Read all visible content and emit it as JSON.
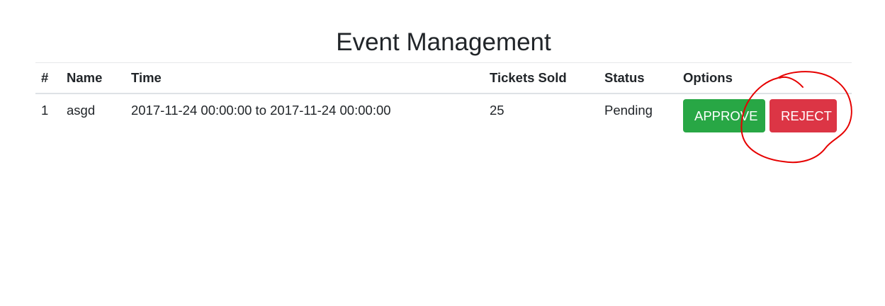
{
  "page": {
    "title": "Event Management"
  },
  "table": {
    "headers": {
      "num": "#",
      "name": "Name",
      "time": "Time",
      "tickets_sold": "Tickets Sold",
      "status": "Status",
      "options": "Options"
    },
    "rows": [
      {
        "num": "1",
        "name": "asgd",
        "time": "2017-11-24 00:00:00 to 2017-11-24 00:00:00",
        "tickets_sold": "25",
        "status": "Pending",
        "approve_label": "APPROVE",
        "reject_label": "REJECT"
      }
    ]
  },
  "colors": {
    "approve": "#28a745",
    "reject": "#dc3545",
    "annotation": "#e60000"
  }
}
